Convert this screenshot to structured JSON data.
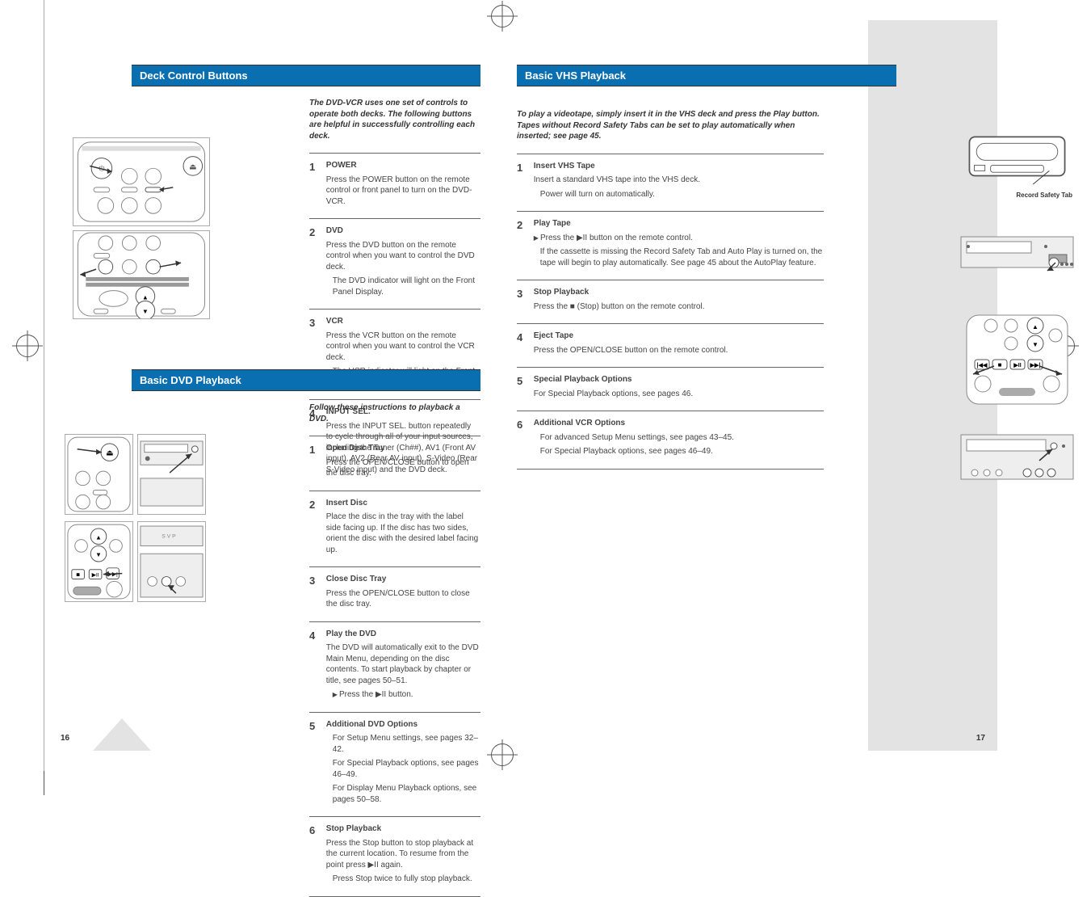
{
  "page_left": {
    "section1": {
      "header": "Deck Control Buttons",
      "intro": "The DVD-VCR uses one set of controls to operate both decks. The following buttons are helpful in successfully controlling each deck.",
      "steps": [
        {
          "num": "1",
          "title": "POWER",
          "body": "Press the POWER button on the remote control or front panel to turn on the DVD-VCR."
        },
        {
          "num": "2",
          "title": "DVD",
          "body": "Press the DVD button on the remote control when you want to control the DVD deck.",
          "bullets": [
            "The DVD indicator will light on the Front Panel Display."
          ]
        },
        {
          "num": "3",
          "title": "VCR",
          "body": "Press the VCR button on the remote control when you want to control the VCR deck.",
          "bullets": [
            "The VCR indicator will light on the Front Panel Display."
          ]
        },
        {
          "num": "4",
          "title": "INPUT SEL.",
          "body": "Press the INPUT SEL. button repeatedly to cycle through all of your input sources, including the Tuner (Ch##), AV1 (Front AV input), AV2 (Rear AV input), S-Video (Rear S-Video input) and the DVD deck."
        }
      ]
    },
    "section2": {
      "header": "Basic DVD Playback",
      "intro": "Follow these instructions to playback a DVD.",
      "steps": [
        {
          "num": "1",
          "title": "Open Disc Tray",
          "body": "Press the OPEN/CLOSE button to open the disc tray."
        },
        {
          "num": "2",
          "title": "Insert Disc",
          "body": "Place the disc in the tray with the label side facing up. If the disc has two sides, orient the disc with the desired label facing up."
        },
        {
          "num": "3",
          "title": "Close Disc Tray",
          "body": "Press the OPEN/CLOSE button to close the disc tray."
        },
        {
          "num": "4",
          "title": "Play the DVD",
          "body": "The DVD will automatically exit to the DVD Main Menu, depending on the disc contents. To start playback by chapter or title, see pages 50–51.",
          "bullets": [
            "Press the ▶II button."
          ]
        },
        {
          "num": "5",
          "title": "Additional DVD Options",
          "body2": [
            "For Setup Menu settings, see pages 32–42.",
            "For Special Playback options, see pages 46–49.",
            "For Display Menu Playback options, see pages 50–58."
          ]
        },
        {
          "num": "6",
          "title": "Stop Playback",
          "body": "Press the Stop button to stop playback at the current location. To resume from the point press ▶II again.",
          "bullets": [
            "Press Stop twice to fully stop playback."
          ]
        }
      ]
    },
    "page_num": "16"
  },
  "page_right": {
    "header": "Basic VHS Playback",
    "intro": "To play a videotape, simply insert it in the VHS deck and press the Play button. Tapes without Record Safety Tabs can be set to play automatically when inserted; see page 45.",
    "steps": [
      {
        "num": "1",
        "title": "Insert VHS Tape",
        "body": "Insert a standard VHS tape into the VHS deck.",
        "bullets": [
          "Power will turn on automatically."
        ]
      },
      {
        "num": "2",
        "title": "Play Tape",
        "body": "Press the ▶II button on the remote control.",
        "bullets": [
          "If the cassette is missing the Record Safety Tab and Auto Play is turned on, the tape will begin to play automatically. See page 45 about the AutoPlay feature."
        ]
      },
      {
        "num": "3",
        "title": "Stop Playback",
        "body": "Press the ■ (Stop) button on the remote control."
      },
      {
        "num": "4",
        "title": "Eject Tape",
        "body": "Press the OPEN/CLOSE button on the remote control."
      },
      {
        "num": "5",
        "title": "Special Playback Options",
        "body": "For Special Playback options, see pages 46."
      },
      {
        "num": "6",
        "title": "Additional VCR Options",
        "body2": [
          "For advanced Setup Menu settings, see pages 43–45.",
          "For Special Playback options, see pages 46–49."
        ]
      }
    ],
    "callouts": {
      "record_tab": "Record Safety Tab"
    },
    "page_num": "17"
  }
}
